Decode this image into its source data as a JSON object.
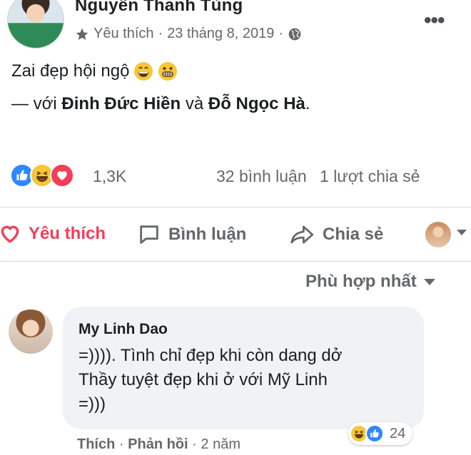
{
  "post": {
    "author": "Nguyễn Thanh Tùng",
    "meta_audience": "Yêu thích",
    "meta_date": "23 tháng 8, 2019",
    "meta_sep": "·",
    "more": "•••",
    "text": "Zai đẹp hội ngộ",
    "with_prefix": "— với",
    "tag1": "Đinh Đức Hiền",
    "and": "và",
    "tag2": "Đỗ Ngọc Hà",
    "period": "."
  },
  "reactions": {
    "count": "1,3K",
    "comments": "32 bình luận",
    "shares": "1 lượt chia sẻ",
    "types": [
      "like-icon",
      "haha-icon",
      "love-icon"
    ]
  },
  "actions": {
    "like": "Yêu thích",
    "comment": "Bình luận",
    "share": "Chia sẻ"
  },
  "sort": {
    "label": "Phù hợp nhất"
  },
  "comment": {
    "name": "My Linh Dao",
    "lines": [
      "=)))). Tình chỉ đẹp khi còn dang dở",
      "Thầy tuyệt đẹp khi ở với Mỹ Linh",
      "=)))"
    ],
    "react_count": "24",
    "like": "Thích",
    "reply": "Phản hồi",
    "time": "2 năm",
    "sep": "·"
  },
  "colors": {
    "like_blue": "#2d88ff",
    "love_red": "#f33e58",
    "haha_yellow": "#f7c73a",
    "muted": "#65676b",
    "bubble": "#f0f2f5"
  }
}
